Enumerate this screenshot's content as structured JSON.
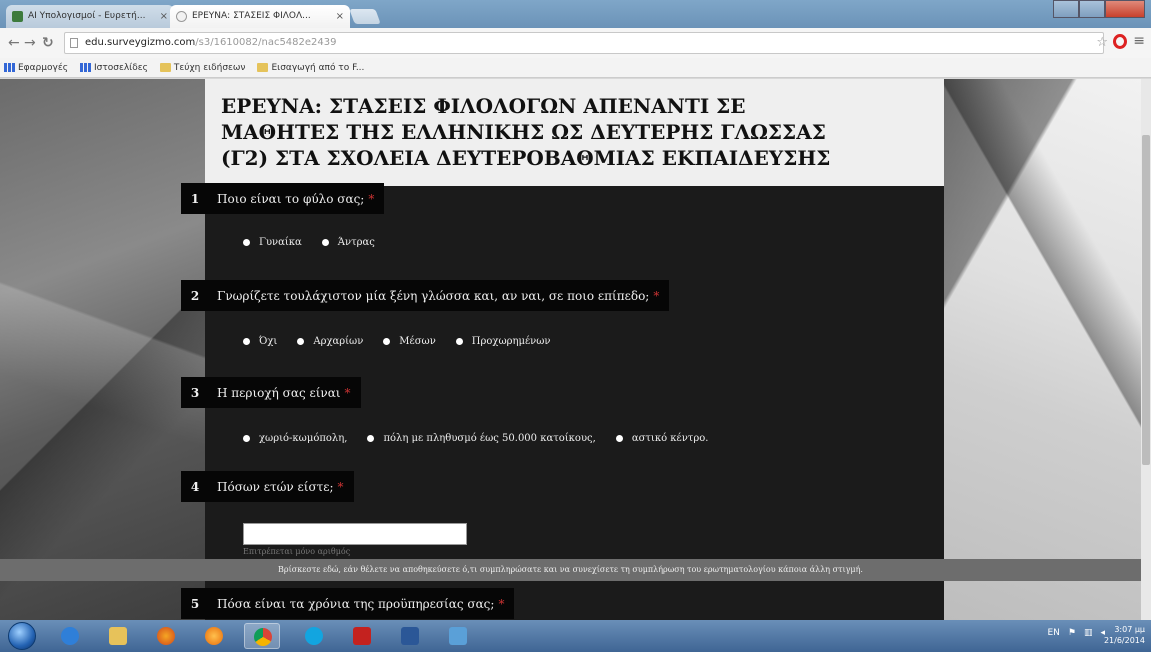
{
  "browser": {
    "tabs": [
      {
        "label": "ΑΙ Υπολογισμοί - Ευρετή...",
        "active": false
      },
      {
        "label": "ΕΡΕΥΝΑ: ΣΤΑΣΕΙΣ ΦΙΛΟΛ...",
        "active": true
      }
    ],
    "close_glyph": "×",
    "url": {
      "domain": "edu.surveygizmo.com",
      "path": "/s3/1610082/nac5482e2439"
    },
    "bookmarks": [
      {
        "label": "Εφαρμογές",
        "icon": "apps-icon"
      },
      {
        "label": "Ιστοσελίδες",
        "icon": "grid-icon"
      },
      {
        "label": "Τεύχη ειδήσεων",
        "icon": "folder-icon"
      },
      {
        "label": "Εισαγωγή από το F...",
        "icon": "folder-icon"
      }
    ]
  },
  "survey": {
    "title_lines": [
      "ΕΡΕΥΝΑ: ΣΤΑΣΕΙΣ ΦΙΛΟΛΟΓΩΝ ΑΠΕΝΑΝΤΙ ΣΕ",
      "ΜΑΘΗΤΕΣ ΤΗΣ ΕΛΛΗΝΙΚΗΣ ΩΣ ΔΕΥΤΕΡΗΣ ΓΛΩΣΣΑΣ",
      "(Γ2) ΣΤΑ ΣΧΟΛΕΙΑ ΔΕΥΤΕΡΟΒΑΘΜΙΑΣ ΕΚΠΑΙΔΕΥΣΗΣ"
    ],
    "required_mark": "*",
    "questions": [
      {
        "number": "1",
        "text": "Ποιο είναι το φύλο σας;",
        "options": [
          "Γυναίκα",
          "Άντρας"
        ]
      },
      {
        "number": "2",
        "text": "Γνωρίζετε τουλάχιστον μία ξένη γλώσσα και, αν ναι, σε ποιο επίπεδο;",
        "options": [
          "Όχι",
          "Αρχαρίων",
          "Μέσων",
          "Προχωρημένων"
        ]
      },
      {
        "number": "3",
        "text": "Η περιοχή σας είναι",
        "options": [
          "χωριό-κωμόπολη,",
          "πόλη με πληθυσμό έως 50.000 κατοίκους,",
          "αστικό κέντρο."
        ]
      },
      {
        "number": "4",
        "text": "Πόσων ετών είστε;",
        "hint": "Επιτρέπεται μόνο αριθμός"
      },
      {
        "number": "5",
        "text": "Πόσα είναι τα χρόνια της προϋπηρεσίας σας;"
      }
    ],
    "banner": "Βρίσκεστε εδώ, εάν θέλετε να αποθηκεύσετε ό,τι συμπληρώσατε και να συνεχίσετε τη συμπλήρωση του ερωτηματολογίου κάποια άλλη στιγμή."
  },
  "taskbar": {
    "apps": [
      "ie-icon",
      "explorer-icon",
      "firefox-icon",
      "media-player-icon",
      "chrome-icon",
      "skype-icon",
      "acrobat-icon",
      "word-icon",
      "paint-icon"
    ],
    "tray_lang": "EN",
    "clock_time": "3:07 μμ",
    "clock_date": "21/6/2014"
  },
  "colors": {
    "survey_bg": "#1b1b1b",
    "title_bg": "#efefef",
    "question_head_bg": "#060606",
    "required": "#cc3333"
  }
}
